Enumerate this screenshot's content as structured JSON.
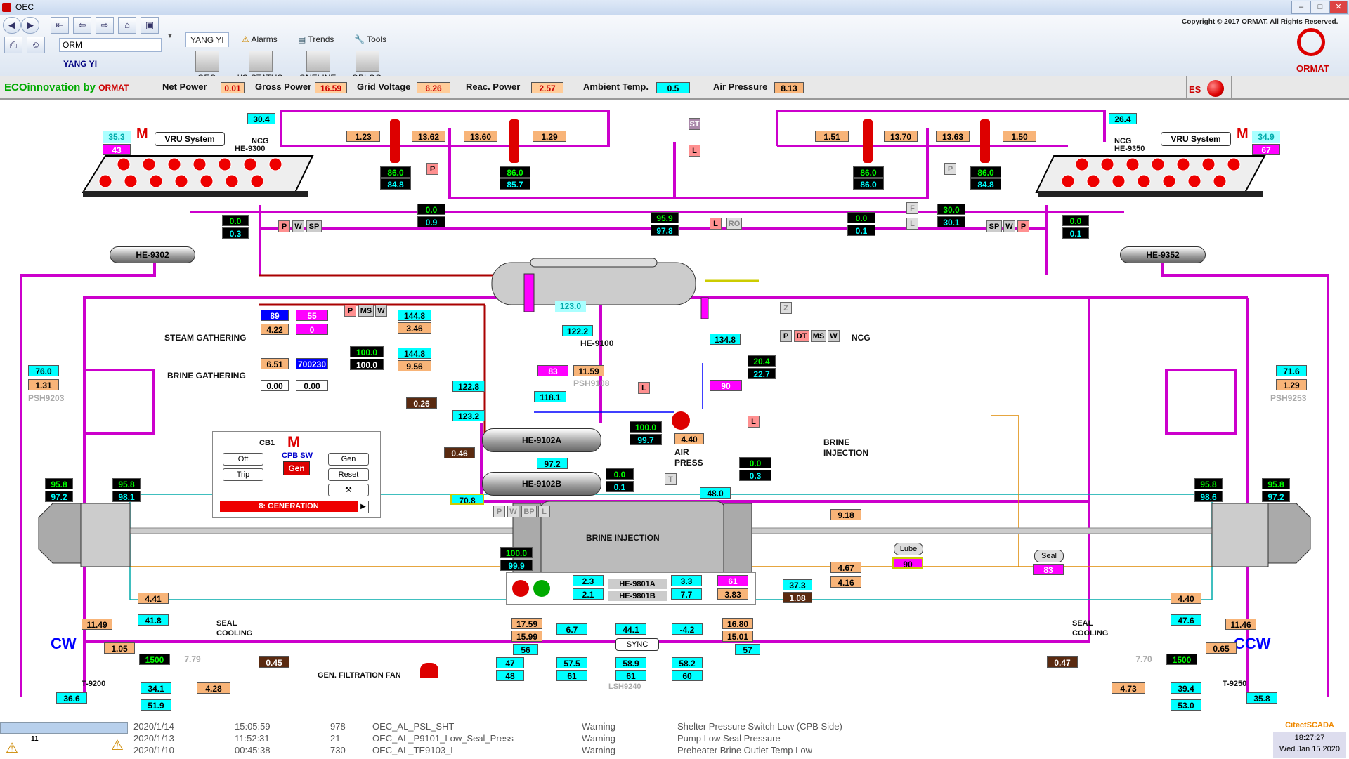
{
  "window": {
    "title": "OEC",
    "copyright": "Copyright © 2017 ORMAT. All Rights Reserved."
  },
  "toolbar": {
    "user_field": "ORM",
    "user_name": "YANG YI",
    "tabs": [
      "YANG YI",
      "Alarms",
      "Trends",
      "Tools"
    ],
    "pages": [
      "OEC",
      "I/O STATUS",
      "ONELINE",
      "OPLOG"
    ],
    "brand": "ORMAT"
  },
  "status": {
    "brand_eco": "ECO",
    "brand_rest": "innovation by",
    "brand_ormat": "ORMAT",
    "net_power_label": "Net Power",
    "net_power": "0.01",
    "gross_power_label": "Gross Power",
    "gross_power": "16.59",
    "grid_voltage_label": "Grid Voltage",
    "grid_voltage": "6.26",
    "reac_power_label": "Reac. Power",
    "reac_power": "2.57",
    "ambient_label": "Ambient Temp.",
    "ambient": "0.5",
    "air_pressure_label": "Air Pressure",
    "air_pressure": "8.13",
    "es": "ES"
  },
  "diagram": {
    "vru_left": "VRU System",
    "ncg_left": "NCG",
    "he9300": "HE-9300",
    "vru_right": "VRU System",
    "ncg_right": "NCG",
    "he9350": "HE-9350",
    "m": "M",
    "left_top_cyan": "30.4",
    "right_top_cyan": "26.4",
    "left_ltc": "35.3",
    "left_mag": "43",
    "right_ltc": "34.9",
    "right_mag": "67",
    "v_1_23": "1.23",
    "v_13_62": "13.62",
    "v_13_60": "13.60",
    "v_1_29": "1.29",
    "v_1_51": "1.51",
    "v_13_70": "13.70",
    "v_13_63": "13.63",
    "v_1_50": "1.50",
    "p1a": "86.0",
    "p1b": "84.8",
    "p2a": "86.0",
    "p2b": "85.7",
    "p3a": "86.0",
    "p3b": "86.0",
    "p4a": "86.0",
    "p4b": "84.8",
    "vl1a": "0.0",
    "vl1b": "0.9",
    "vr1a": "30.0",
    "vr1b": "30.1",
    "v00a": "0.0",
    "v03": "0.3",
    "vr00": "0.0",
    "vr01": "0.1",
    "vr2a": "0.0",
    "vr2b": "0.1",
    "mid_a": "95.9",
    "mid_b": "97.8",
    "st": "ST",
    "l": "L",
    "p": "P",
    "w": "W",
    "sp": "SP",
    "f": "F",
    "ro": "RO",
    "he9302": "HE-9302",
    "he9352": "HE-9352",
    "he9100": "HE-9100",
    "v123": "123.0",
    "v122_2": "122.2",
    "v134_8": "134.8",
    "v20_4": "20.4",
    "v22_7": "22.7",
    "ncg": "NCG",
    "z": "Z",
    "dt": "DT",
    "ms": "MS",
    "steam": "STEAM GATHERING",
    "brine": "BRINE GATHERING",
    "sg89": "89",
    "sg55": "55",
    "sg4_22": "4.22",
    "sg0": "0",
    "v144_8a": "144.8",
    "v3_46": "3.46",
    "v100a": "100.0",
    "v100b": "100.0",
    "v144_8b": "144.8",
    "v9_56": "9.56",
    "bg6_51": "6.51",
    "bg700230": "700230",
    "bg0a": "0.00",
    "bg0b": "0.00",
    "v0_26": "0.26",
    "v122_8": "122.8",
    "v83": "83",
    "v11_59": "11.59",
    "psh9108": "PSH9108",
    "v90": "90",
    "v118_1": "118.1",
    "v123_2": "123.2",
    "he9102a": "HE-9102A",
    "v0_46": "0.46",
    "v100c": "100.0",
    "v99_7": "99.7",
    "v4_40": "4.40",
    "air": "AIR",
    "press": "PRESS",
    "bi_a": "0.0",
    "bi_b": "0.3",
    "brine_inj": "BRINE",
    "injection": "INJECTION",
    "v97_2": "97.2",
    "he9102b": "HE-9102B",
    "vb00": "0.0",
    "vb01": "0.1",
    "t": "T",
    "v48_0": "48.0",
    "v70_8": "70.8",
    "bp": "BP",
    "bi2a": "100.0",
    "bi2b": "99.9",
    "brine_inj2": "BRINE INJECTION",
    "cb1": "CB1",
    "cpbsw": "CPB SW",
    "gen": "Gen",
    "off": "Off",
    "trip": "Trip",
    "reset": "Reset",
    "generation": "8: GENERATION",
    "l76": "76.0",
    "l131": "1.31",
    "psh9203": "PSH9203",
    "r716": "71.6",
    "r129": "1.29",
    "psh9253": "PSH9253",
    "l958a": "95.8",
    "l972a": "97.2",
    "l958b": "95.8",
    "l981": "98.1",
    "r958a": "95.8",
    "r986": "98.6",
    "r958b": "95.8",
    "r972": "97.2",
    "v9_18": "9.18",
    "v4_67": "4.67",
    "v4_16": "4.16",
    "lube": "Lube",
    "lube90": "90",
    "v37_3": "37.3",
    "v1_08": "1.08",
    "seal": "Seal",
    "seal83": "83",
    "he9801a": "HE-9801A",
    "he9801b": "HE-9801B",
    "h23": "2.3",
    "h21": "2.1",
    "h33": "3.3",
    "h77": "7.7",
    "h61": "61",
    "h383": "3.83",
    "cw": "CW",
    "ccw": "CCW",
    "t9200": "T-9200",
    "t9250": "T-9250",
    "l441": "4.41",
    "l418": "41.8",
    "l1149": "11.49",
    "l105": "1.05",
    "l1500": "1500",
    "l779": "7.79",
    "l045": "0.45",
    "l366": "36.6",
    "l341": "34.1",
    "l428": "4.28",
    "l519": "51.9",
    "r440": "4.40",
    "r476": "47.6",
    "r1146": "11.46",
    "r065": "0.65",
    "r1500": "1500",
    "r770": "7.70",
    "r047": "0.47",
    "r358": "35.8",
    "r394": "39.4",
    "r473": "4.73",
    "r530": "53.0",
    "seal_cooling": "SEAL",
    "cooling": "COOLING",
    "gen_fan": "GEN. FILTRATION FAN",
    "g1759": "17.59",
    "g1599": "15.99",
    "g67": "6.7",
    "g441": "44.1",
    "gm42": "-4.2",
    "g1680": "16.80",
    "g1501": "15.01",
    "g56": "56",
    "g57": "57",
    "g47": "47",
    "g48": "48",
    "g575": "57.5",
    "g589": "58.9",
    "g582": "58.2",
    "g61a": "61",
    "g61b": "61",
    "g60": "60",
    "sync": "SYNC",
    "lsh9240": "LSH9240"
  },
  "alarms": [
    {
      "date": "2020/1/14",
      "time": "15:05:59",
      "id": "978",
      "tag": "OEC_AL_PSL_SHT",
      "type": "Warning",
      "desc": "Shelter Pressure Switch Low (CPB Side)"
    },
    {
      "date": "2020/1/13",
      "time": "11:52:31",
      "id": "21",
      "tag": "OEC_AL_P9101_Low_Seal_Press",
      "type": "Warning",
      "desc": "Pump Low Seal Pressure"
    },
    {
      "date": "2020/1/10",
      "time": "00:45:38",
      "id": "730",
      "tag": "OEC_AL_TE9103_L",
      "type": "Warning",
      "desc": "Preheater Brine Outlet Temp Low"
    }
  ],
  "clock": {
    "brand": "CitectSCADA",
    "time": "18:27:27",
    "date": "Wed Jan 15 2020"
  },
  "alarm_count": "11"
}
